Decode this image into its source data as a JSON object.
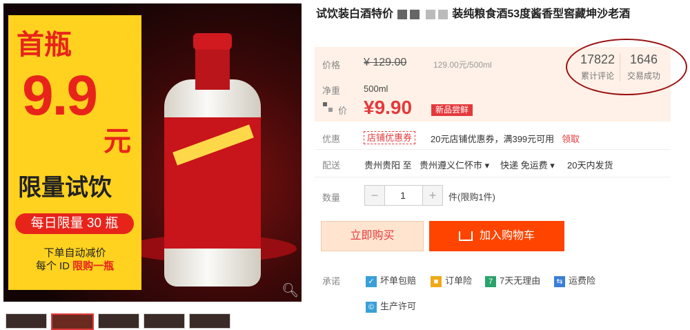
{
  "hero": {
    "promo_first": "首瓶",
    "promo_price": "9.9",
    "promo_yuan": "元",
    "promo_limit": "限量试饮",
    "promo_pill": "每日限量 30 瓶",
    "promo_note1": "下单自动减价",
    "promo_note2_prefix": "每个 ID ",
    "promo_note2_highlight": "限购一瓶"
  },
  "product": {
    "title_part1": "试饮装白酒特价",
    "title_part2": "装纯粮食酒53度酱香型窖藏坤沙老酒"
  },
  "price_box": {
    "price_label": "价格",
    "old_price": "¥ 129.00",
    "unit_price": "129.00元/500ml",
    "weight_label": "净重",
    "weight_value": "500ml",
    "sale_label": "价",
    "sale_price": "¥9.90",
    "new_badge": "新品尝鲜",
    "reviews_count": "17822",
    "reviews_label": "累计评论",
    "sales_count": "1646",
    "sales_label": "交易成功"
  },
  "coupon": {
    "label": "优惠",
    "tag": "店铺优惠券",
    "text": "20元店铺优惠券，满399元可用",
    "claim": "领取"
  },
  "shipping": {
    "label": "配送",
    "from": "贵州贵阳 至",
    "to": "贵州遵义仁怀市",
    "method": "快递 免运费",
    "dispatch": "20天内发货"
  },
  "quantity": {
    "label": "数量",
    "minus": "−",
    "value": "1",
    "plus": "+",
    "note": "件(限购1件)"
  },
  "actions": {
    "buy_now": "立即购买",
    "add_to_cart": "加入购物车"
  },
  "promises": {
    "label": "承诺",
    "items": [
      "坏单包赔",
      "订单险",
      "7天无理由",
      "运费险",
      "生产许可"
    ]
  },
  "colors": {
    "accent": "#e4393c",
    "cart": "#ff4400",
    "promo_yellow": "#ffd21f",
    "price_bg": "#fff1e7"
  }
}
